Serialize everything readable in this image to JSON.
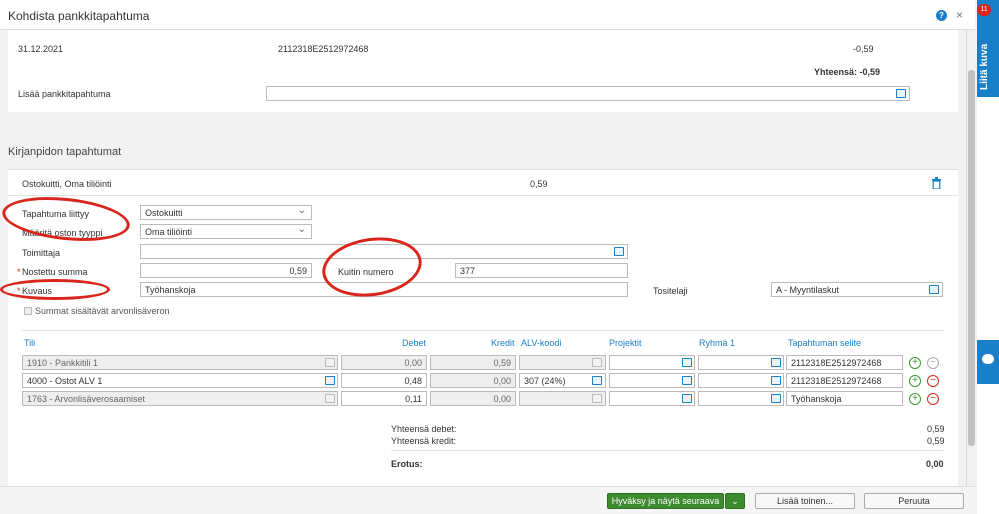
{
  "dialog": {
    "title": "Kohdista pankkitapahtuma",
    "help": "?",
    "close": "×"
  },
  "sidetab": {
    "label": "Liitä kuva",
    "badge": "11"
  },
  "bank": {
    "date": "31.12.2021",
    "ref": "2112318E2512972468",
    "amount": "-0,59",
    "total": "Yhteensä: -0,59",
    "add_label": "Lisää pankkitapahtuma",
    "add_value": ""
  },
  "section": {
    "title": "Kirjanpidon tapahtumat"
  },
  "entry": {
    "summary_label": "Ostokuitti, Oma tiliöinti",
    "summary_amount": "0,59",
    "tapahtuma_label": "Tapahtuma liittyy",
    "tapahtuma_value": "Ostokuitti",
    "maarita_label": "Määritä oston tyyppi",
    "maarita_value": "Oma tiliöinti",
    "toimittaja_label": "Toimittaja",
    "toimittaja_value": "",
    "nostettu_label": "Nostettu summa",
    "nostettu_value": "0,59",
    "kuitti_label": "Kuitin numero",
    "kuitti_value": "377",
    "kuvaus_label": "Kuvaus",
    "kuvaus_value": "Työhanskoja",
    "tositelaji_label": "Tositelaji",
    "tositelaji_value": "A - Myyntilaskut",
    "summat_label": "Summat sisältävät arvonlisäveron",
    "required_mark": "*"
  },
  "table": {
    "headers": [
      "Tili",
      "Debet",
      "Kredit",
      "ALV-koodi",
      "Projektit",
      "Ryhmä 1",
      "Tapahtuman selite"
    ],
    "rows": [
      {
        "tili": "1910 - Pankkitili 1",
        "debet": "0,00",
        "kredit": "0,59",
        "alv": "",
        "projektit": "",
        "ryhma": "",
        "selite": "2112318E2512972468",
        "plus": "+",
        "minus": "−"
      },
      {
        "tili": "4000 - Ostot ALV 1",
        "debet": "0,48",
        "kredit": "0,00",
        "alv": "307 (24%)",
        "projektit": "",
        "ryhma": "",
        "selite": "2112318E2512972468",
        "plus": "+",
        "minus": "−"
      },
      {
        "tili": "1763 - Arvonlisäverosaamiset",
        "debet": "0,11",
        "kredit": "0,00",
        "alv": "",
        "projektit": "",
        "ryhma": "",
        "selite": "Työhanskoja",
        "plus": "+",
        "minus": "−"
      }
    ]
  },
  "totals": {
    "debet_label": "Yhteensä debet:",
    "debet_value": "0,59",
    "kredit_label": "Yhteensä kredit:",
    "kredit_value": "0,59",
    "erotus_label": "Erotus:",
    "erotus_value": "0,00"
  },
  "footer": {
    "approve": "Hyväksy ja näytä seuraava",
    "approve_caret": "⌄",
    "add_another": "Lisää toinen...",
    "cancel": "Peruuta"
  },
  "colors": {
    "accent": "#1a7fc9",
    "approve": "#3d8b2f",
    "annotation": "#d9261c"
  }
}
